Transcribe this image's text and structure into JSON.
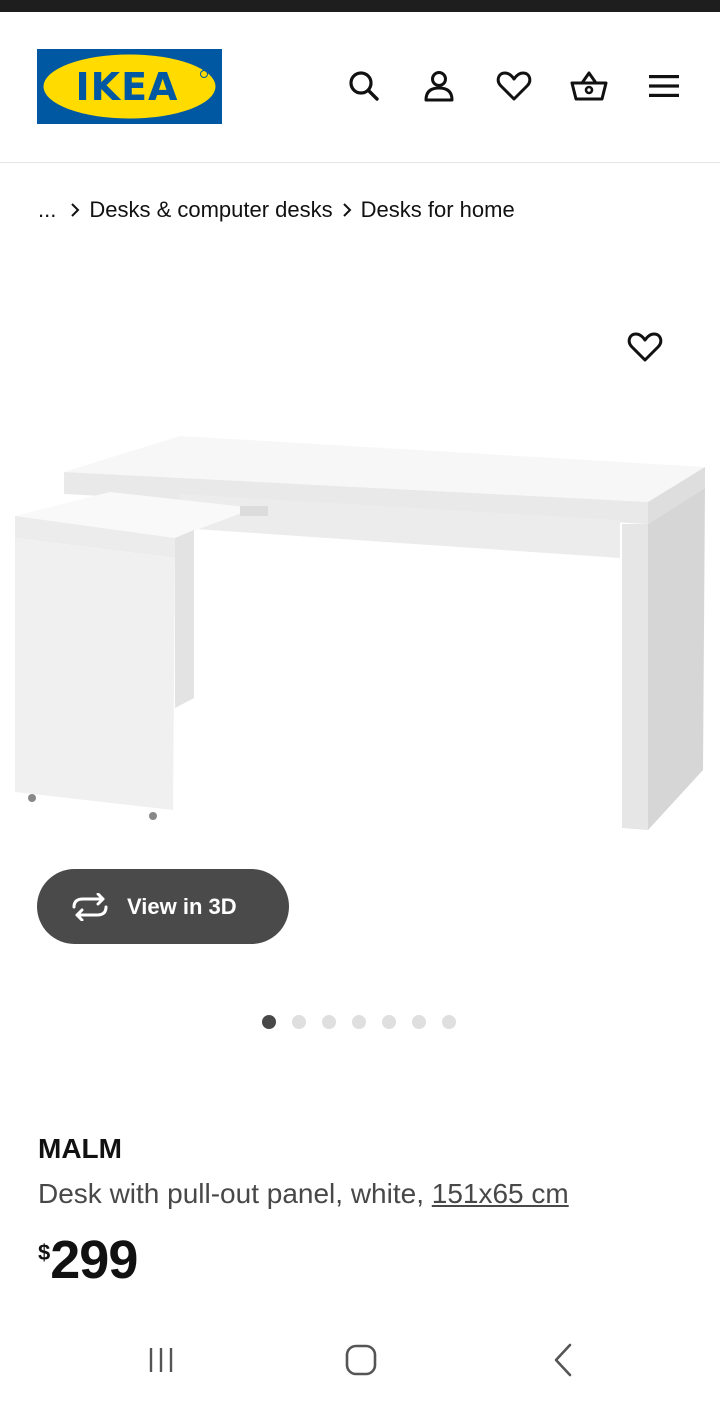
{
  "brand_logo": {
    "text": "IKEA",
    "colors": {
      "blue": "#0058a3",
      "yellow": "#ffdb00"
    }
  },
  "header_icons": [
    "search-icon",
    "account-icon",
    "heart-icon",
    "basket-icon",
    "menu-icon"
  ],
  "breadcrumb": {
    "ellipsis": "...",
    "items": [
      "Desks & computer desks",
      "Desks for home"
    ]
  },
  "gallery": {
    "view_3d_label": "View in 3D",
    "slides_total": 7,
    "active_slide": 1
  },
  "product": {
    "name": "MALM",
    "description": "Desk with pull-out panel, white, ",
    "measurement": "151x65 cm",
    "currency": "$",
    "price": "299"
  },
  "system_nav": [
    "recent-apps-icon",
    "home-icon",
    "back-icon"
  ]
}
